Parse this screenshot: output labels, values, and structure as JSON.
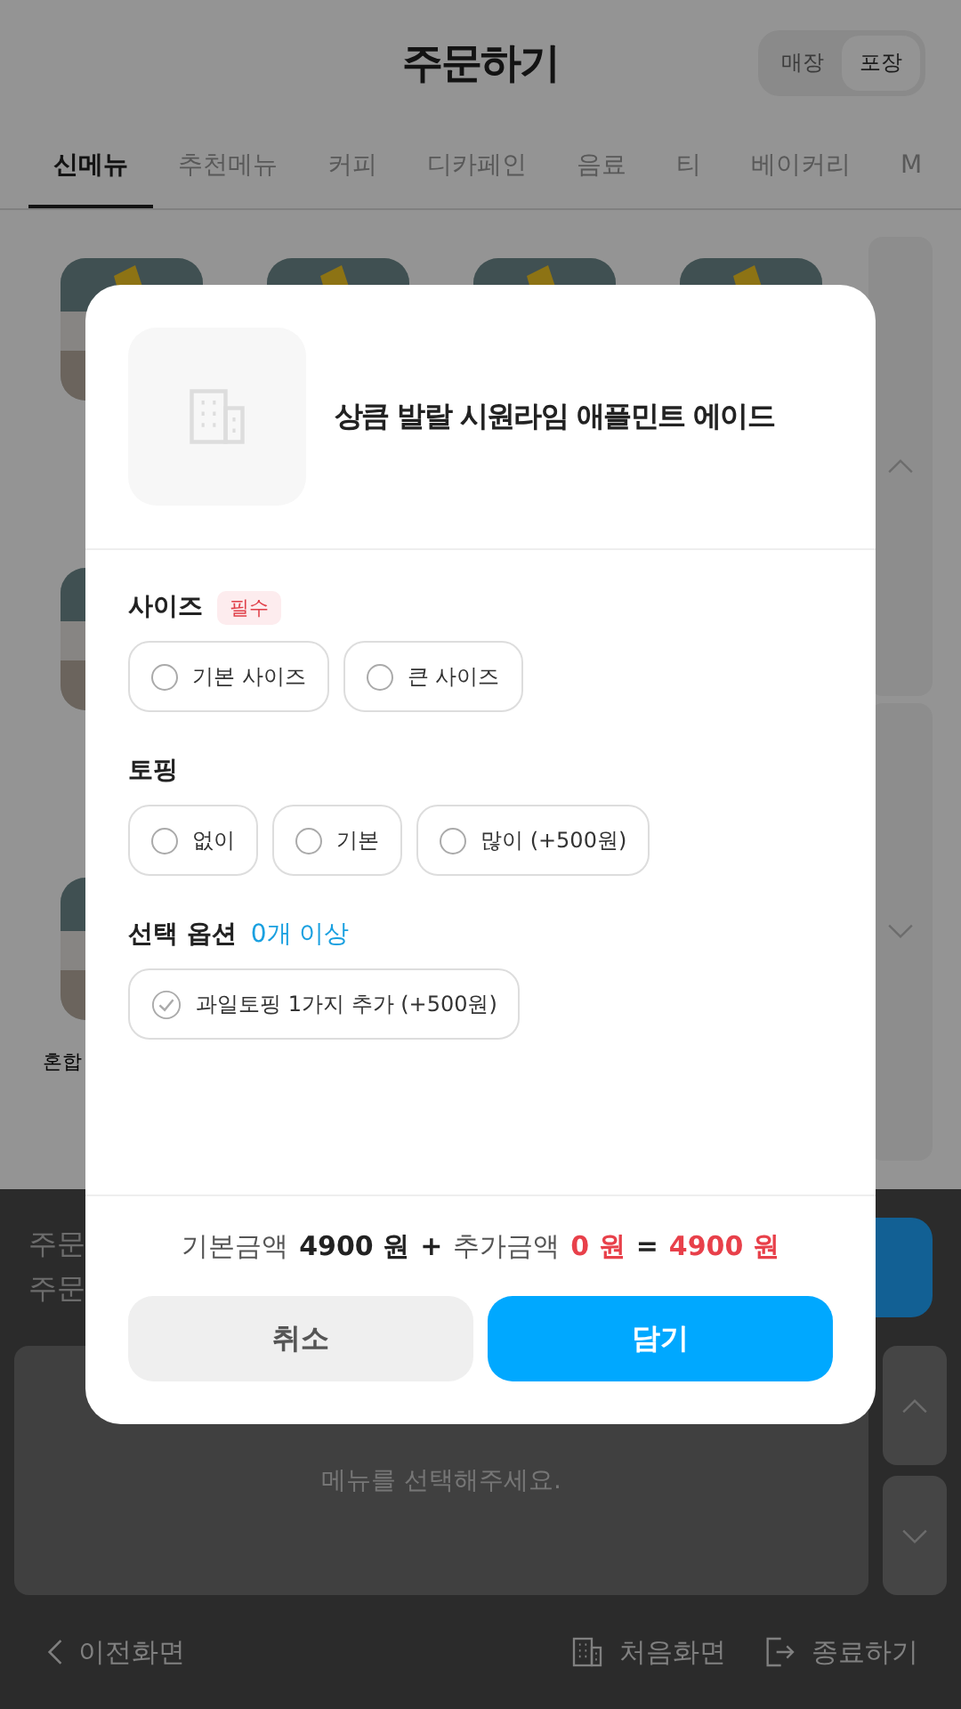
{
  "header": {
    "title": "주문하기",
    "dine_options": [
      {
        "label": "매장",
        "selected": false
      },
      {
        "label": "포장",
        "selected": true
      }
    ]
  },
  "tabs": [
    {
      "label": "신메뉴",
      "selected": true
    },
    {
      "label": "추천메뉴",
      "selected": false
    },
    {
      "label": "커피",
      "selected": false
    },
    {
      "label": "디카페인",
      "selected": false
    },
    {
      "label": "음료",
      "selected": false
    },
    {
      "label": "티",
      "selected": false
    },
    {
      "label": "베이커리",
      "selected": false
    },
    {
      "label": "M",
      "selected": false
    }
  ],
  "menu_rows": [
    {
      "items": [
        {
          "kind": "picture"
        },
        {
          "kind": "picture"
        },
        {
          "kind": "picture"
        },
        {
          "kind": "picture"
        }
      ]
    },
    {
      "items": [
        {
          "kind": "picture"
        }
      ]
    },
    {
      "items": [
        {
          "kind": "picture",
          "name": "혼합"
        }
      ]
    }
  ],
  "order_summary": {
    "lines": [
      "주문",
      "주문"
    ]
  },
  "cart": {
    "empty_message": "메뉴를 선택해주세요."
  },
  "footer": {
    "back": "이전화면",
    "home": "처음화면",
    "exit": "종료하기"
  },
  "dialog": {
    "title": "상큼 발랄 시원라임 애플민트 에이드",
    "option_groups": [
      {
        "title": "사이즈",
        "badge": "필수",
        "kind": "radio",
        "options": [
          {
            "label": "기본 사이즈",
            "selected": false
          },
          {
            "label": "큰 사이즈",
            "selected": false
          }
        ]
      },
      {
        "title": "토핑",
        "kind": "radio",
        "options": [
          {
            "label": "없이",
            "selected": false
          },
          {
            "label": "기본",
            "selected": false
          },
          {
            "label": "많이 (+500원)",
            "selected": false
          }
        ]
      },
      {
        "title": "선택 옵션",
        "note": "0개 이상",
        "kind": "check",
        "options": [
          {
            "label": "과일토핑 1가지 추가 (+500원)",
            "checked": false
          }
        ]
      }
    ],
    "price": {
      "base_label": "기본금액",
      "base_value": "4900 원",
      "plus": "+",
      "extra_label": "추가금액",
      "extra_value": "0 원",
      "equals": "=",
      "total_value": "4900 원"
    },
    "buttons": {
      "cancel": "취소",
      "confirm": "담기"
    }
  }
}
